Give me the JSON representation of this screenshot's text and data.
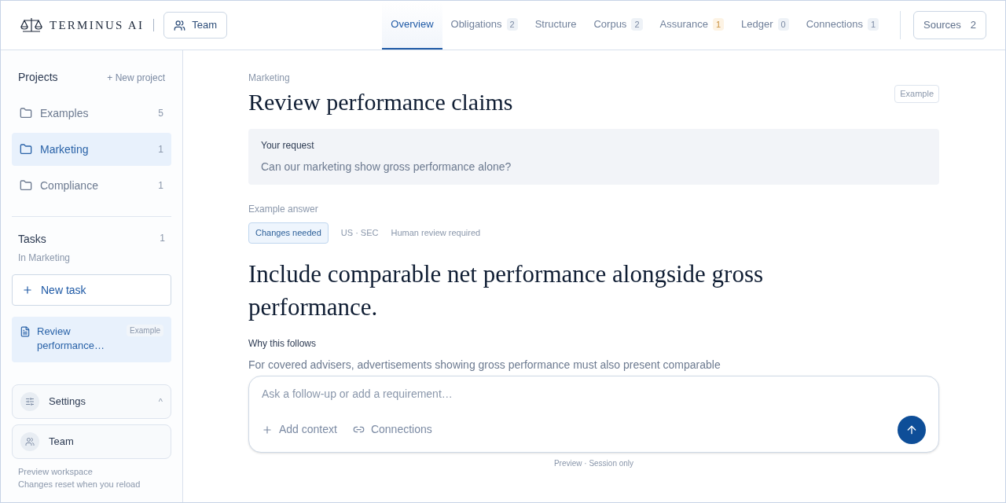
{
  "brand": {
    "name": "TERMINUS AI",
    "team_button": "Team"
  },
  "tabs": [
    {
      "label": "Overview",
      "selected": true
    },
    {
      "label": "Obligations",
      "badge": "2",
      "kind": "neutral",
      "selected": false
    },
    {
      "label": "Structure",
      "selected": false
    },
    {
      "label": "Corpus",
      "badge": "2",
      "kind": "neutral",
      "selected": false
    },
    {
      "label": "Assurance",
      "badge": "1",
      "kind": "warning",
      "selected": false
    },
    {
      "label": "Ledger",
      "badge": "0",
      "kind": "neutral",
      "selected": false
    },
    {
      "label": "Connections",
      "badge": "1",
      "kind": "neutral",
      "selected": false
    }
  ],
  "sources_button": {
    "label": "Sources",
    "count": "2"
  },
  "sidebar": {
    "projects_title": "Projects",
    "new_project": "+ New project",
    "projects": [
      {
        "name": "Examples",
        "count": "5",
        "selected": false
      },
      {
        "name": "Marketing",
        "count": "1",
        "selected": true
      },
      {
        "name": "Compliance",
        "count": "1",
        "selected": false
      }
    ],
    "tasks_title": "Tasks",
    "tasks_count": "1",
    "tasks_scope": "In Marketing",
    "new_task": "New task",
    "tasks": [
      {
        "title": "Review performance…",
        "tag": "Example",
        "selected": true
      }
    ],
    "settings": {
      "label": "Settings",
      "caret": "^"
    },
    "team": "Team",
    "footer": [
      "Preview workspace",
      "Changes reset when you reload"
    ]
  },
  "main": {
    "breadcrumb": "Marketing",
    "title": "Review performance claims",
    "tag": "Example",
    "request_label": "Your request",
    "request": "Can our marketing show gross performance alone?",
    "answer_label": "Example answer",
    "status": "Changes needed",
    "meta": [
      "US · SEC",
      "Human review required"
    ],
    "answer": "Include comparable net performance alongside gross performance.",
    "why_label": "Why this follows",
    "why_text": "For covered advisers, advertisements showing gross performance must also present comparable"
  },
  "composer": {
    "placeholder": "Ask a follow-up or add a requirement…",
    "add_context": "Add context",
    "connections": "Connections",
    "note": "Preview · Session only"
  }
}
